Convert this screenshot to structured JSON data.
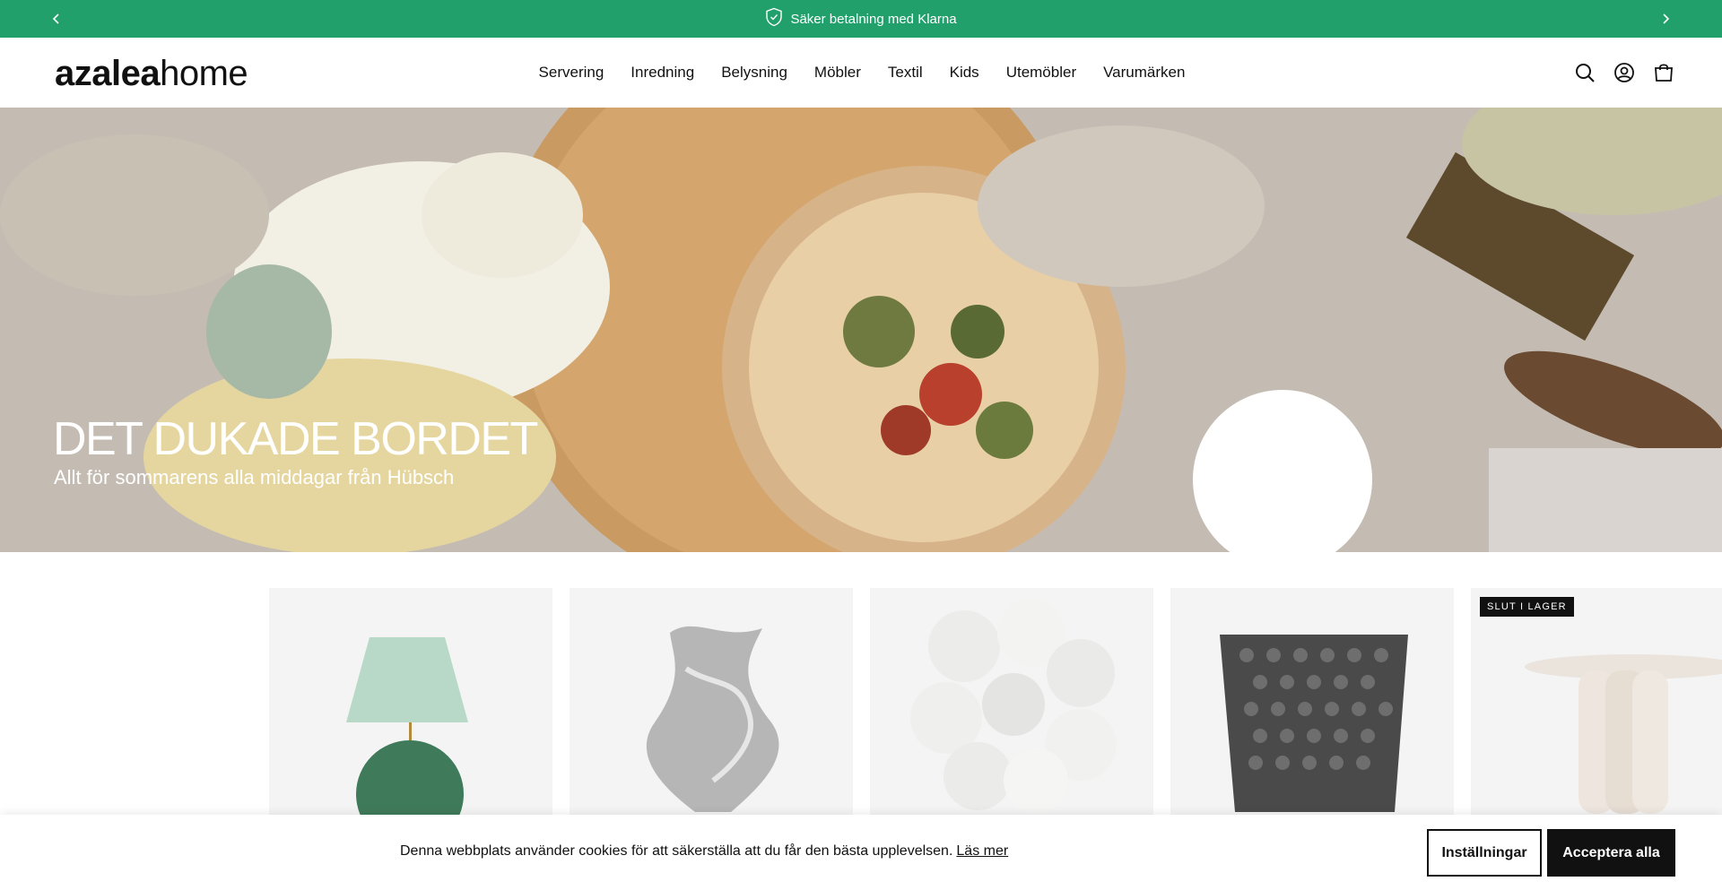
{
  "announcement": {
    "text": "Säker betalning med Klarna",
    "bg_color": "#22a06b"
  },
  "logo": {
    "part1": "azalea",
    "part2": "home"
  },
  "nav": [
    "Servering",
    "Inredning",
    "Belysning",
    "Möbler",
    "Textil",
    "Kids",
    "Utemöbler",
    "Varumärken"
  ],
  "header_icons": [
    "search-icon",
    "account-icon",
    "cart-icon"
  ],
  "hero": {
    "title": "DET DUKADE BORDET",
    "subtitle": "Allt för sommarens alla middagar från Hübsch"
  },
  "products": [
    {
      "name": "table-lamp",
      "badge": ""
    },
    {
      "name": "glass-vase",
      "badge": ""
    },
    {
      "name": "bubble-lamp",
      "badge": ""
    },
    {
      "name": "textured-pot",
      "badge": ""
    },
    {
      "name": "side-table",
      "badge": "SLUT I LAGER"
    }
  ],
  "cookie": {
    "text": "Denna webbplats använder cookies för att säkerställa att du får den bästa upplevelsen.",
    "link": "Läs mer",
    "settings_label": "Inställningar",
    "accept_label": "Acceptera alla"
  }
}
